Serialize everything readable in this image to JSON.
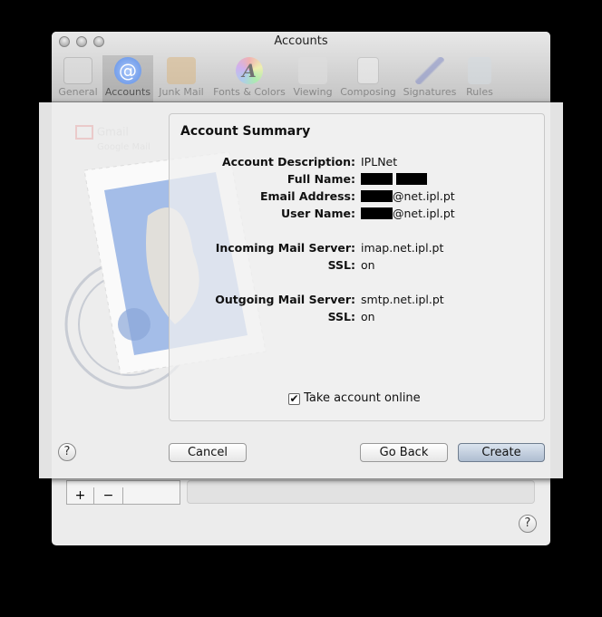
{
  "window": {
    "title": "Accounts"
  },
  "toolbar": {
    "items": [
      {
        "label": "General",
        "icon": "switch-icon",
        "color": "#dddddd"
      },
      {
        "label": "Accounts",
        "icon": "at-icon",
        "color": "#7aa5ee"
      },
      {
        "label": "Junk Mail",
        "icon": "junk-bag-icon",
        "color": "#d9b98a"
      },
      {
        "label": "Fonts & Colors",
        "icon": "font-color-wheel-icon",
        "color": "#c9a0d8"
      },
      {
        "label": "Viewing",
        "icon": "glasses-envelope-icon",
        "color": "#cfcfcf"
      },
      {
        "label": "Composing",
        "icon": "pencil-paper-icon",
        "color": "#e8d9a8"
      },
      {
        "label": "Signatures",
        "icon": "pen-signature-icon",
        "color": "#8a93c8"
      },
      {
        "label": "Rules",
        "icon": "rules-arrows-icon",
        "color": "#c4ccd4"
      }
    ],
    "selected": "Accounts"
  },
  "background": {
    "account_name": "Gmail",
    "account_type": "Google Mail",
    "add": "+",
    "remove": "−",
    "help": "?"
  },
  "sheet": {
    "heading": "Account Summary",
    "rows": [
      {
        "label": "Account Description:",
        "value": "IPLNet"
      },
      {
        "label": "Full Name:",
        "value": ""
      },
      {
        "label": "Email Address:",
        "value": "@net.ipl.pt"
      },
      {
        "label": "User Name:",
        "value": "@net.ipl.pt"
      },
      {
        "label": "Incoming Mail Server:",
        "value": "imap.net.ipl.pt"
      },
      {
        "label": "SSL:",
        "value": "on"
      },
      {
        "label": "Outgoing Mail Server:",
        "value": "smtp.net.ipl.pt"
      },
      {
        "label": "SSL:",
        "value": "on"
      }
    ],
    "take_online": {
      "label": "Take account online",
      "checked": true
    },
    "help": "?",
    "cancel": "Cancel",
    "go_back": "Go Back",
    "create": "Create"
  }
}
